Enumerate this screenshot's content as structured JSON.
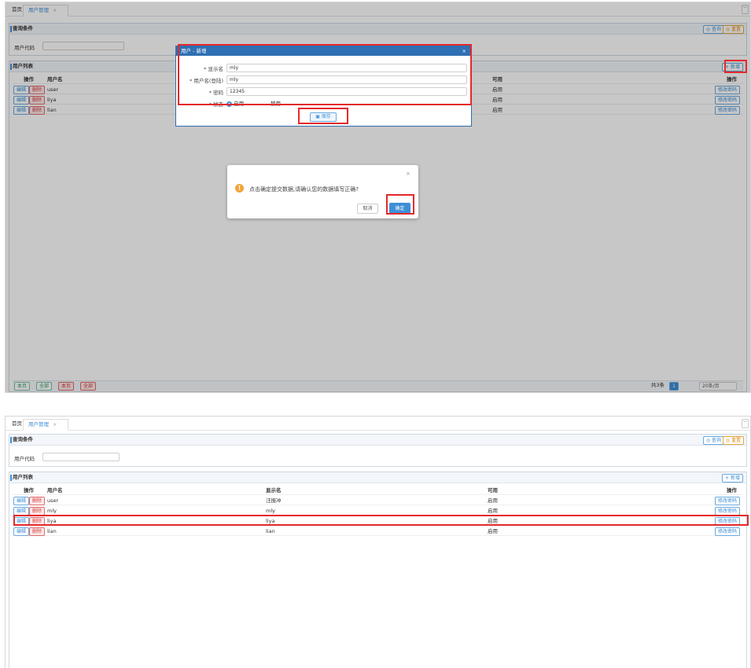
{
  "tabs": {
    "home": "首页",
    "active": "用户管理",
    "close": "×",
    "dropdown": "﹀"
  },
  "query": {
    "title": "查询条件",
    "field_label": "用户代码",
    "query_btn": "◎ 查询",
    "reset_btn": "◎ 重置"
  },
  "list": {
    "title": "用户列表",
    "add_btn": "+ 新增",
    "headers": {
      "op": "操作",
      "username": "用户名",
      "display": "显示名",
      "enabled": "可用",
      "op2": "操作"
    },
    "edit": "编辑",
    "delete": "删除",
    "change_pwd": "修改密码"
  },
  "top_rows": [
    {
      "username": "user",
      "enabled": "启用"
    },
    {
      "username": "liya",
      "enabled": "启用"
    },
    {
      "username": "lian",
      "enabled": "启用"
    }
  ],
  "modal": {
    "title": "用户 - 新增",
    "close": "×",
    "display_label": "* 显示名",
    "display_value": "mly",
    "username_label": "* 用户名(登陆)",
    "username_value": "mly",
    "password_label": "* 密码",
    "password_value": "12345",
    "status_label": "* 状态",
    "status_enabled": "启用",
    "status_disabled": "禁用",
    "save_btn": "保存"
  },
  "confirm": {
    "message": "点击确定提交数据,请确认您的数据填写正确?",
    "close": "×",
    "cancel": "取消",
    "ok": "确定"
  },
  "footer": {
    "btns": [
      "本页",
      "全部",
      "本页",
      "全部"
    ],
    "total": "共3条",
    "page": "1",
    "page_size": "20条/页"
  },
  "bottom_rows": [
    {
      "username": "user",
      "display": "汪振冲",
      "enabled": "启用"
    },
    {
      "username": "mly",
      "display": "mly",
      "enabled": "启用"
    },
    {
      "username": "liya",
      "display": "liya",
      "enabled": "启用"
    },
    {
      "username": "lian",
      "display": "lian",
      "enabled": "启用"
    }
  ]
}
